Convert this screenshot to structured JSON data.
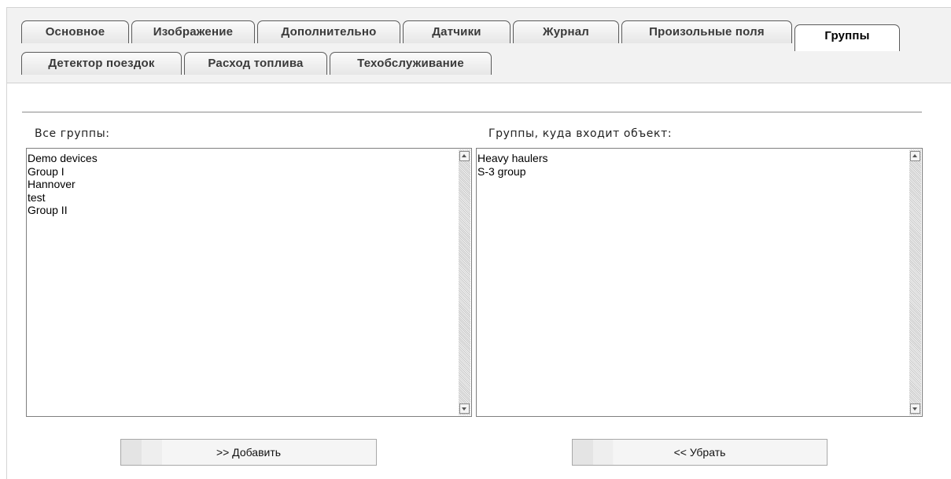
{
  "tabs": {
    "row1": [
      "Основное",
      "Изображение",
      "Дополнительно",
      "Датчики",
      "Журнал",
      "Произольные поля",
      "Группы"
    ],
    "row2": [
      "Детектор поездок",
      "Расход топлива",
      "Техобслуживание"
    ],
    "active": "Группы"
  },
  "all_groups": {
    "label": "Все группы:",
    "items": [
      "Demo devices",
      "Group I",
      "Hannover",
      "test",
      "Group II"
    ]
  },
  "member_groups": {
    "label": "Группы, куда входит объект:",
    "items": [
      "Heavy haulers",
      "S-3 group"
    ]
  },
  "buttons": {
    "add": ">> Добавить",
    "remove": "<< Убрать"
  },
  "icons": {
    "scroll_up": "scroll-up-arrow",
    "scroll_down": "scroll-down-arrow"
  }
}
